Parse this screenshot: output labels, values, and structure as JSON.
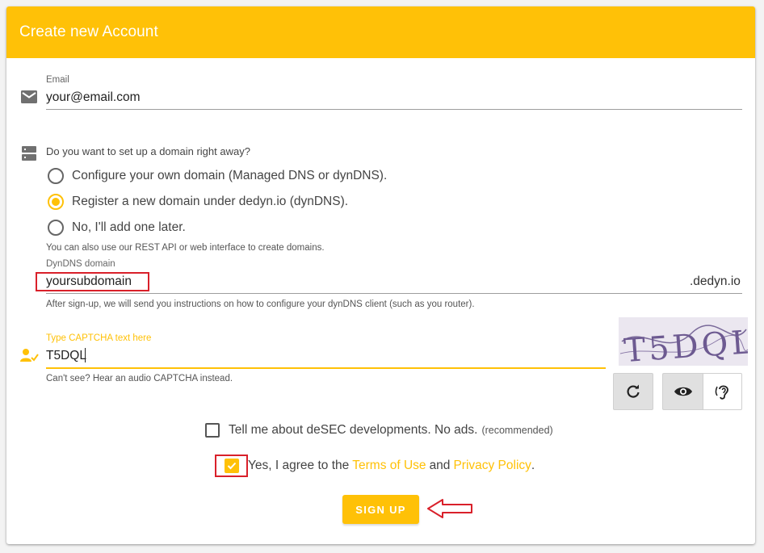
{
  "header": {
    "title": "Create new Account"
  },
  "email": {
    "label": "Email",
    "value": "your@email.com"
  },
  "domain_setup": {
    "question": "Do you want to set up a domain right away?",
    "options": [
      {
        "label": "Configure your own domain (Managed DNS or dynDNS).",
        "selected": false
      },
      {
        "label": "Register a new domain under dedyn.io (dynDNS).",
        "selected": true
      },
      {
        "label": "No, I'll add one later.",
        "selected": false
      }
    ],
    "hint": "You can also use our REST API or web interface to create domains."
  },
  "dyndns": {
    "label": "DynDNS domain",
    "value": "yoursubdomain",
    "suffix": ".dedyn.io",
    "hint": "After sign-up, we will send you instructions on how to configure your dynDNS client (such as you router)."
  },
  "captcha": {
    "label": "Type CAPTCHA text here",
    "value": "T5DQL",
    "hint": "Can't see? Hear an audio CAPTCHA instead.",
    "image_text": "T5DQL"
  },
  "newsletter": {
    "label": "Tell me about deSEC developments. No ads.",
    "note": "(recommended)",
    "checked": false
  },
  "terms": {
    "prefix": "Yes, I agree to the",
    "terms_link": "Terms of Use",
    "and": "and",
    "privacy_link": "Privacy Policy",
    "suffix": ".",
    "checked": true
  },
  "signup": {
    "label": "SIGN UP"
  },
  "colors": {
    "accent": "#ffc107",
    "annotation": "#d9202a"
  }
}
